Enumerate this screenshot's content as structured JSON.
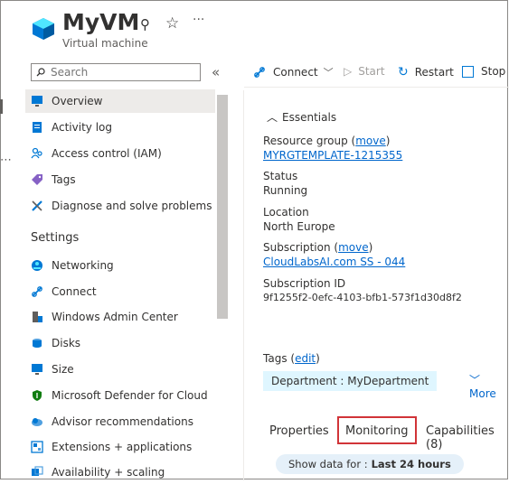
{
  "header": {
    "title": "MyVM",
    "subtitle": "Virtual machine"
  },
  "search": {
    "placeholder": "Search"
  },
  "nav": {
    "items": [
      {
        "label": "Overview",
        "icon": "monitor-icon"
      },
      {
        "label": "Activity log",
        "icon": "log-icon"
      },
      {
        "label": "Access control (IAM)",
        "icon": "people-icon"
      },
      {
        "label": "Tags",
        "icon": "tag-icon"
      },
      {
        "label": "Diagnose and solve problems",
        "icon": "wrench-icon"
      }
    ],
    "section": "Settings",
    "settings_items": [
      {
        "label": "Networking",
        "icon": "network-icon"
      },
      {
        "label": "Connect",
        "icon": "plug-icon"
      },
      {
        "label": "Windows Admin Center",
        "icon": "server-icon"
      },
      {
        "label": "Disks",
        "icon": "disk-icon"
      },
      {
        "label": "Size",
        "icon": "size-monitor-icon"
      },
      {
        "label": "Microsoft Defender for Cloud",
        "icon": "shield-icon"
      },
      {
        "label": "Advisor recommendations",
        "icon": "cloud-advisor-icon"
      },
      {
        "label": "Extensions + applications",
        "icon": "extensions-icon"
      },
      {
        "label": "Availability + scaling",
        "icon": "availability-icon"
      }
    ]
  },
  "commands": {
    "connect": "Connect",
    "start": "Start",
    "restart": "Restart",
    "stop": "Stop"
  },
  "essentials": {
    "title": "Essentials",
    "resource_group_label": "Resource group",
    "resource_group_move": "move",
    "resource_group": "MYRGTEMPLATE-1215355",
    "status_label": "Status",
    "status": "Running",
    "location_label": "Location",
    "location": "North Europe",
    "subscription_label": "Subscription",
    "subscription_move": "move",
    "subscription": "CloudLabsAI.com SS - 044",
    "subscription_id_label": "Subscription ID",
    "subscription_id": "9f1255f2-0efc-4103-bfb1-573f1d30d8f2"
  },
  "tags": {
    "label": "Tags",
    "edit": "edit",
    "chip": "Department : MyDepartment",
    "more": "More"
  },
  "tabs": {
    "properties": "Properties",
    "monitoring": "Monitoring",
    "capabilities": "Capabilities (8)"
  },
  "show_data": {
    "prefix": "Show data for :",
    "value": "Last 24 hours"
  },
  "colors": {
    "link": "#0066cc",
    "highlight": "#d13438",
    "tag_bg": "#dff6ff",
    "active_nav": "#edebe9"
  }
}
